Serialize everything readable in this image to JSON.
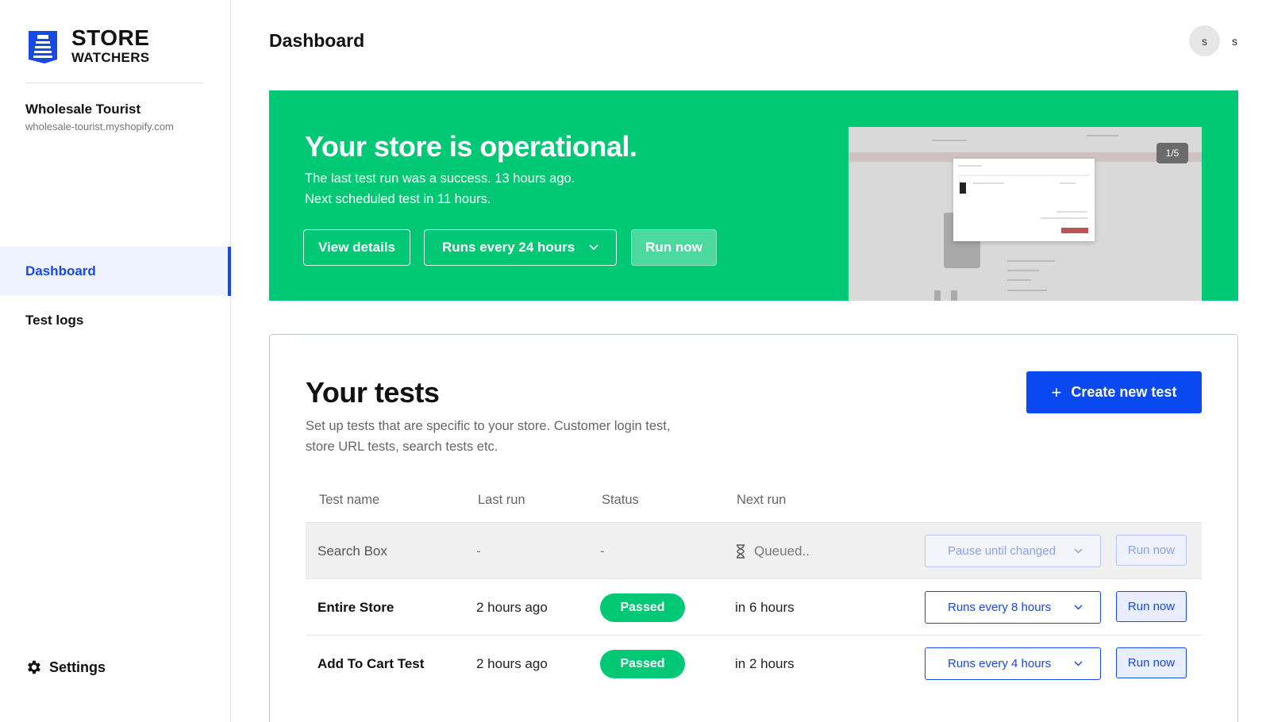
{
  "brand": {
    "line1": "STORE",
    "line2": "WATCHERS",
    "color": "#1848e8"
  },
  "store": {
    "name": "Wholesale Tourist",
    "url": "wholesale-tourist.myshopify.com"
  },
  "nav": {
    "items": [
      {
        "label": "Dashboard",
        "active": true
      },
      {
        "label": "Test logs",
        "active": false
      }
    ],
    "settings": "Settings"
  },
  "header": {
    "title": "Dashboard",
    "avatar_initial": "s",
    "user_name": "s"
  },
  "banner": {
    "title": "Your store is operational.",
    "line1": "The last test run was a success. 13 hours ago.",
    "line2": "Next scheduled test in 11 hours.",
    "view_details": "View details",
    "schedule": "Runs every 24 hours",
    "run_now": "Run now",
    "preview_counter": "1/5",
    "color": "#00c875"
  },
  "tests": {
    "title": "Your tests",
    "description": "Set up tests that are specific to your store. Customer login test, store URL tests, search tests etc.",
    "create_button": "Create new test",
    "columns": [
      "Test name",
      "Last run",
      "Status",
      "Next run"
    ],
    "rows": [
      {
        "name": "Search Box",
        "last_run": "-",
        "status": "-",
        "next_run": "Queued..",
        "schedule": "Pause until changed",
        "run_label": "Run now"
      },
      {
        "name": "Entire Store",
        "last_run": "2 hours ago",
        "status": "Passed",
        "next_run": "in 6 hours",
        "schedule": "Runs every 8 hours",
        "run_label": "Run now"
      },
      {
        "name": "Add To Cart Test",
        "last_run": "2 hours ago",
        "status": "Passed",
        "next_run": "in 2 hours",
        "schedule": "Runs every 4 hours",
        "run_label": "Run now"
      }
    ]
  }
}
